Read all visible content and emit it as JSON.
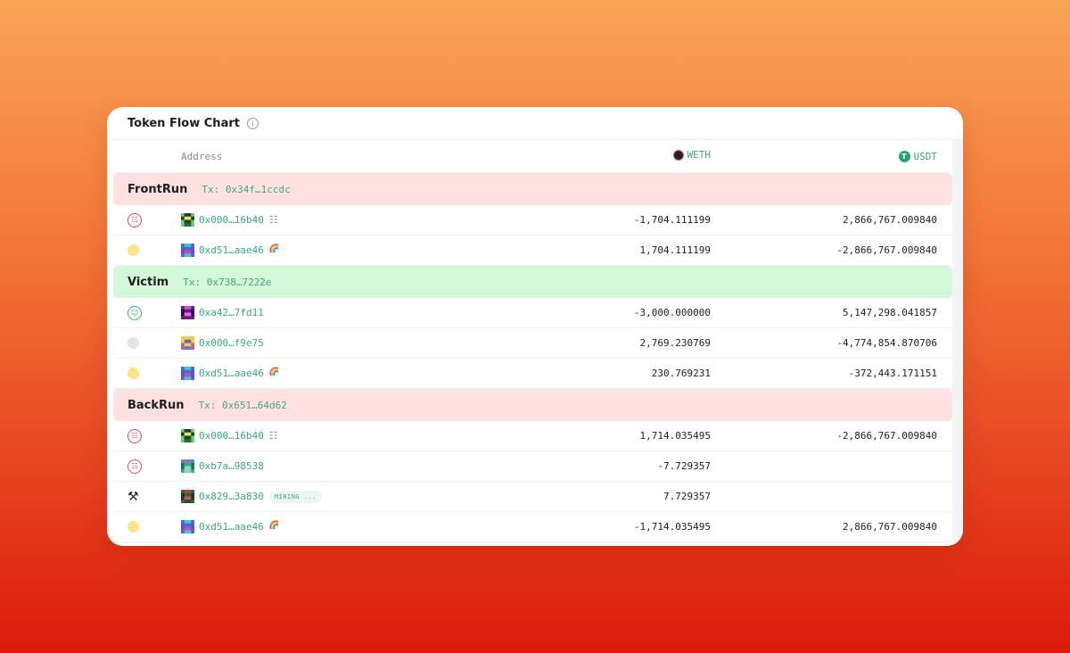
{
  "card": {
    "title": "Token Flow Chart"
  },
  "header": {
    "address_label": "Address",
    "token1": "WETH",
    "token2": "USDT"
  },
  "colors": {
    "frontrun_bg": "#ffe1e1",
    "victim_bg": "#d3f7d9",
    "backrun_bg": "#ffe1e1",
    "accent": "#3aa77a"
  },
  "sections": [
    {
      "title": "FrontRun",
      "tx": "Tx: 0x34f…1ccdc",
      "bg": "#ffe1e1",
      "rows": [
        {
          "icon": "red-robot-face-icon",
          "avatar": "a1",
          "address": "0x000…16b40",
          "tag": "robot-icon",
          "weth": "-1,704.111199",
          "usdt": "2,866,767.009840"
        },
        {
          "icon": "yellow-dot-icon",
          "avatar": "a2",
          "address": "0xd51…aae46",
          "tag": "rainbow-icon",
          "weth": "1,704.111199",
          "usdt": "-2,866,767.009840"
        }
      ]
    },
    {
      "title": "Victim",
      "tx": "Tx: 0x738…7222e",
      "bg": "#d3f7d9",
      "rows": [
        {
          "icon": "green-face-icon",
          "avatar": "a3",
          "address": "0xa42…7fd11",
          "tag": "",
          "weth": "-3,000.000000",
          "usdt": "5,147,298.041857"
        },
        {
          "icon": "grey-dot-icon",
          "avatar": "a4",
          "address": "0x000…f9e75",
          "tag": "",
          "weth": "2,769.230769",
          "usdt": "-4,774,854.870706"
        },
        {
          "icon": "yellow-dot-icon",
          "avatar": "a2",
          "address": "0xd51…aae46",
          "tag": "rainbow-icon",
          "weth": "230.769231",
          "usdt": "-372,443.171151"
        }
      ]
    },
    {
      "title": "BackRun",
      "tx": "Tx: 0x651…64d62",
      "bg": "#ffe1e1",
      "rows": [
        {
          "icon": "red-robot-face-icon",
          "avatar": "a1",
          "address": "0x000…16b40",
          "tag": "robot-icon",
          "weth": "1,714.035495",
          "usdt": "-2,866,767.009840"
        },
        {
          "icon": "red-robot-face-icon",
          "avatar": "a5",
          "address": "0xb7a…98538",
          "tag": "",
          "weth": "-7.729357",
          "usdt": ""
        },
        {
          "icon": "hammer-icon",
          "avatar": "a6",
          "address": "0x829…3a830",
          "tag": "mining",
          "mining_label": "MINING ...",
          "weth": "7.729357",
          "usdt": ""
        },
        {
          "icon": "yellow-dot-icon",
          "avatar": "a2",
          "address": "0xd51…aae46",
          "tag": "rainbow-icon",
          "weth": "-1,714.035495",
          "usdt": "2,866,767.009840"
        }
      ]
    }
  ]
}
